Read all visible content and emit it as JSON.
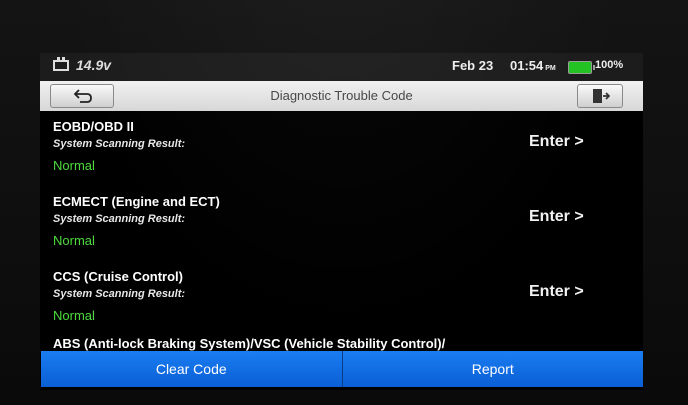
{
  "status_bar": {
    "voltage": "14.9v",
    "date": "Feb 23",
    "time": "01:54",
    "ampm": "PM",
    "battery_percent": "100%",
    "icons": {
      "car_battery": "car-battery-icon",
      "battery": "battery-icon"
    },
    "battery_color": "#22c322"
  },
  "title_bar": {
    "title": "Diagnostic Trouble Code",
    "back_icon": "back-arrow-icon",
    "exit_icon": "exit-icon"
  },
  "systems": [
    {
      "name": "EOBD/OBD II",
      "scan_label": "System Scanning Result:",
      "result": "Normal",
      "action": "Enter >"
    },
    {
      "name": "ECMECT (Engine and ECT)",
      "scan_label": "System Scanning Result:",
      "result": "Normal",
      "action": "Enter >"
    },
    {
      "name": "CCS (Cruise Control)",
      "scan_label": "System Scanning Result:",
      "result": "Normal",
      "action": "Enter >"
    },
    {
      "name": "ABS (Anti-lock Braking System)/VSC (Vehicle Stability Control)/"
    }
  ],
  "bottom_bar": {
    "clear_label": "Clear Code",
    "report_label": "Report"
  },
  "colors": {
    "accent_blue": "#1a7df2",
    "normal_green": "#4ddc3c"
  }
}
